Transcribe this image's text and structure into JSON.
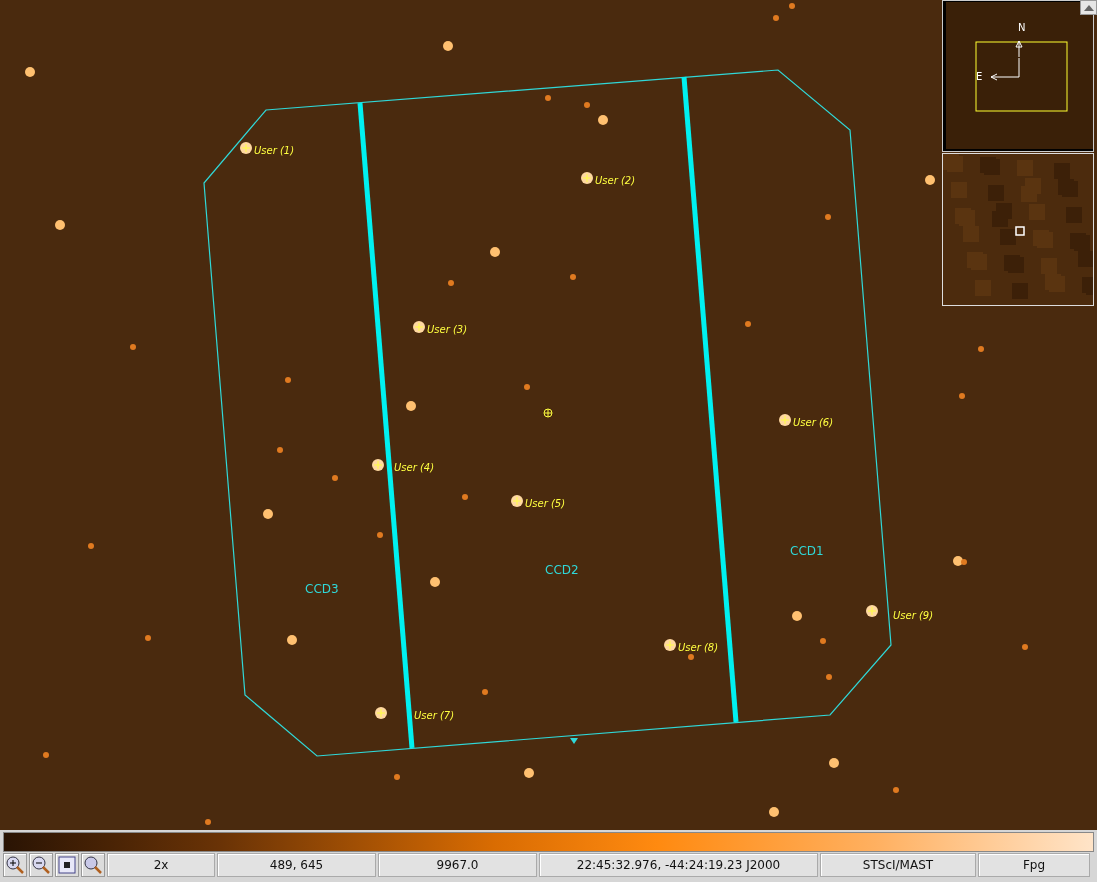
{
  "sky_view": {
    "chips": [
      {
        "label": "CCD3"
      },
      {
        "label": "CCD2"
      },
      {
        "label": "CCD1"
      }
    ],
    "markers": [
      {
        "label": "User (1)"
      },
      {
        "label": "User (2)"
      },
      {
        "label": "User (3)"
      },
      {
        "label": "User (4)"
      },
      {
        "label": "User (5)"
      },
      {
        "label": "User (6)"
      },
      {
        "label": "User (7)"
      },
      {
        "label": "User (8)"
      },
      {
        "label": "User (9)"
      }
    ]
  },
  "pan_window": {
    "north": "N",
    "east": "E"
  },
  "status_bar": {
    "zoom": "2x",
    "pixel": "489, 645",
    "value": "9967.0",
    "coordinates": "22:45:32.976, -44:24:19.23 J2000",
    "server": "STScI/MAST",
    "colormap": "Fpg"
  }
}
